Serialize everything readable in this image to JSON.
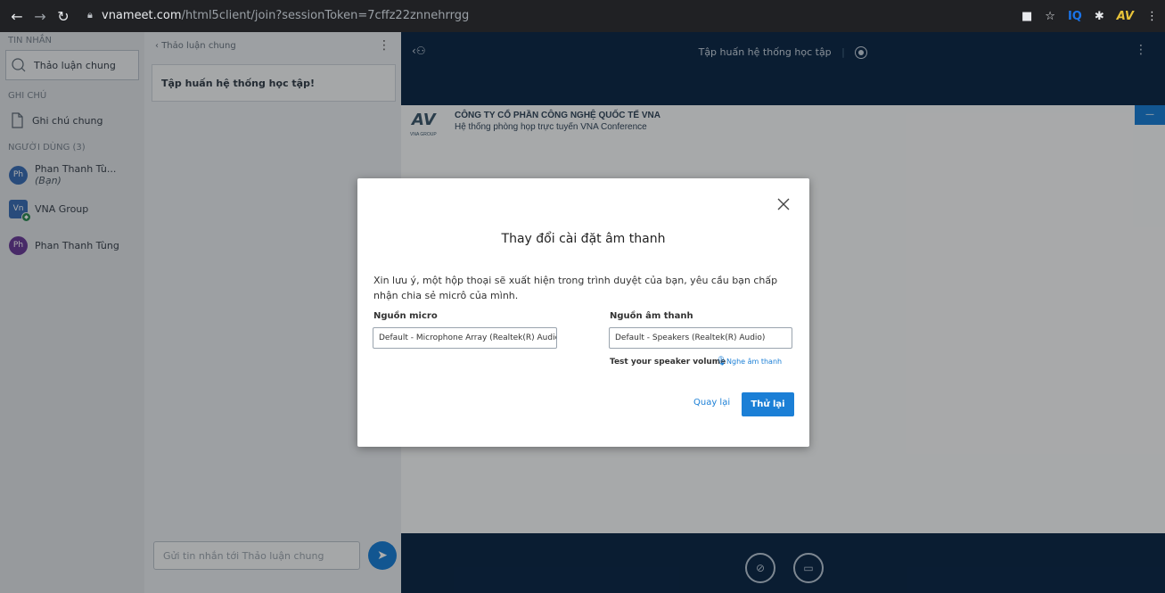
{
  "browser": {
    "host": "vnameet.com",
    "path": "/html5client/join?sessionToken=7cffz22znnehrrgg"
  },
  "sidebar": {
    "messages_label": "TIN NHẮN",
    "public_chat": "Thảo luận chung",
    "notes_label": "GHI CHÚ",
    "shared_notes": "Ghi chú chung",
    "users_label": "NGƯỜI DÙNG (3)",
    "users": [
      {
        "initials": "Ph",
        "name": "Phan Thanh Tù...",
        "suffix": "(Bạn)",
        "color": "#3b6fb6"
      },
      {
        "initials": "Vn",
        "name": "VNA Group",
        "suffix": "",
        "color": "#3b6fb6"
      },
      {
        "initials": "Ph",
        "name": "Phan Thanh Tùng",
        "suffix": "",
        "color": "#6a3e9a"
      }
    ]
  },
  "chat": {
    "back_title": "Thảo luận chung",
    "welcome": "Tập huấn hệ thống học tập!",
    "input_placeholder": "Gửi tin nhắn tới Thảo luận chung"
  },
  "main": {
    "title": "Tập huấn hệ thống học tập",
    "slide_company": "CÔNG TY CỔ PHẦN CÔNG NGHỆ QUỐC TẾ VNA",
    "slide_subtitle": "Hệ thống phòng họp trực tuyến VNA Conference",
    "slide_logo_caption": "VNA GROUP"
  },
  "modal": {
    "title": "Thay đổi cài đặt âm thanh",
    "description": "Xin lưu ý, một hộp thoại sẽ xuất hiện trong trình duyệt của bạn, yêu cầu bạn chấp nhận chia sẻ micrô của mình.",
    "mic_label": "Nguồn micro",
    "mic_value": "Default - Microphone Array (Realtek(R) Audio)",
    "speaker_label": "Nguồn âm thanh",
    "speaker_value": "Default - Speakers (Realtek(R) Audio)",
    "test_label": "Test your speaker volume",
    "play_sound": "Nghe âm thanh",
    "back_label": "Quay lại",
    "retry_label": "Thử lại"
  },
  "colors": {
    "accent": "#1b7fd6",
    "main_bg": "#0f2b4b"
  }
}
